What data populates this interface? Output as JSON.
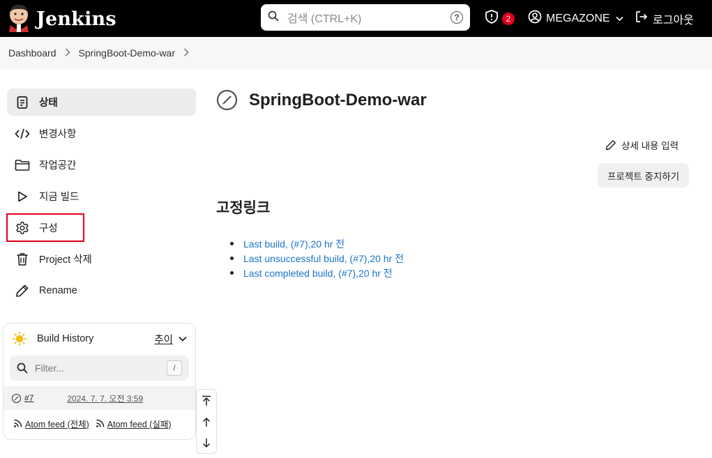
{
  "header": {
    "title": "Jenkins",
    "search_placeholder": "검색 (CTRL+K)",
    "security_count": "2",
    "user": "MEGAZONE",
    "logout": "로그아웃"
  },
  "breadcrumb": [
    "Dashboard",
    "SpringBoot-Demo-war"
  ],
  "sidebar": {
    "items": [
      {
        "label": "상태",
        "icon": "status-icon"
      },
      {
        "label": "변경사항",
        "icon": "code-icon"
      },
      {
        "label": "작업공간",
        "icon": "folder-icon"
      },
      {
        "label": "지금 빌드",
        "icon": "play-icon"
      },
      {
        "label": "구성",
        "icon": "gear-icon"
      },
      {
        "label": "Project 삭제",
        "icon": "trash-icon"
      },
      {
        "label": "Rename",
        "icon": "pencil-icon"
      }
    ]
  },
  "build_history": {
    "title": "Build History",
    "trend": "추이",
    "filter_placeholder": "Filter...",
    "filter_shortcut": "/",
    "builds": [
      {
        "number": "#7",
        "date": "2024. 7. 7. 오전 3:59"
      }
    ],
    "atom_all": "Atom feed (전체)",
    "atom_failed": "Atom feed (실패)"
  },
  "main": {
    "project_name": "SpringBoot-Demo-war",
    "edit_description": "상세 내용 입력",
    "disable_project": "프로젝트 중지하기",
    "permalinks_title": "고정링크",
    "permalinks": [
      "Last build, (#7),20 hr 전",
      "Last unsuccessful build, (#7),20 hr 전",
      "Last completed build, (#7),20 hr 전"
    ]
  },
  "colors": {
    "header_bg": "#000000",
    "link": "#1a73c8",
    "badge": "#e2001a",
    "highlight": "#e2001a"
  }
}
